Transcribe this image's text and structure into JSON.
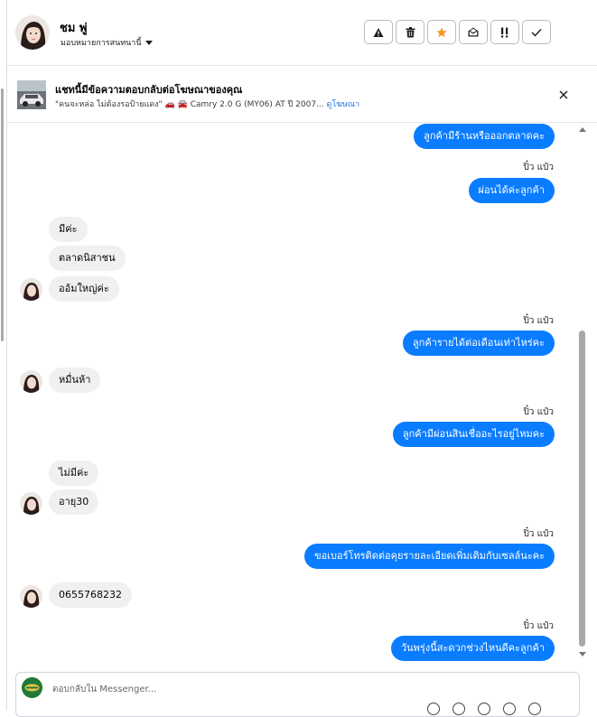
{
  "header": {
    "contact_name": "ชม พู่",
    "assign_label": "มอบหมายการสนทนานี้",
    "toolbar": [
      {
        "name": "spam-button",
        "icon": "warning-triangle-icon"
      },
      {
        "name": "delete-button",
        "icon": "trash-icon"
      },
      {
        "name": "star-button",
        "icon": "star-icon"
      },
      {
        "name": "mark-unread-button",
        "icon": "envelope-open-icon"
      },
      {
        "name": "follow-up-button",
        "icon": "exclamation-icon"
      },
      {
        "name": "done-button",
        "icon": "check-icon"
      }
    ],
    "star_color": "#f7931e"
  },
  "ad": {
    "title": "แชทนี้มีข้อความตอบกลับต่อโฆษณาของคุณ",
    "subtitle": "\"คนจะหล่อ ไม่ต้องรอป้ายแดง\" 🚗 🚘 Camry 2.0 G (MY06) AT ปี 2007...",
    "link": "ดูโฆษณา"
  },
  "messages": [
    {
      "dir": "out",
      "text": "ลูกค้ามีร้านหรือออกตลาดคะ"
    },
    {
      "dir": "out",
      "sender": "ปิ๋ว แป๋ว",
      "text": "ผ่อนได้ค่ะลูกค้า"
    },
    {
      "dir": "in",
      "text": "มีค่ะ"
    },
    {
      "dir": "in",
      "text": "ตลาดนิสาชน"
    },
    {
      "dir": "in",
      "text": "ออ้มใหญ่ค่ะ",
      "avatar": true
    },
    {
      "dir": "out",
      "sender": "ปิ๋ว แป๋ว",
      "text": "ลูกค้ารายได้ต่อเดือนเท่าไหร่คะ"
    },
    {
      "dir": "in",
      "text": "หมื่นห้า",
      "avatar": true
    },
    {
      "dir": "out",
      "sender": "ปิ๋ว แป๋ว",
      "text": "ลูกค้ามีผ่อนสินเชื่ออะไรอยู่ไหมคะ"
    },
    {
      "dir": "in",
      "text": "ไม่มีค่ะ"
    },
    {
      "dir": "in",
      "text": "อายุ30",
      "avatar": true
    },
    {
      "dir": "out",
      "sender": "ปิ๋ว แป๋ว",
      "text": "ขอเบอร์โทรติดต่อคุยรายละเอียดเพิ่มเติมกับเซลล์นะคะ"
    },
    {
      "dir": "in",
      "text": "0655768232",
      "avatar": true
    },
    {
      "dir": "out",
      "sender": "ปิ๋ว แป๋ว",
      "text": "วันพรุ่งนี้สะดวกช่วงไหนดีคะลูกค้า"
    }
  ],
  "composer": {
    "placeholder": "ตอบกลับใน Messenger..."
  },
  "colors": {
    "outgoing_bubble": "#0a7cff",
    "incoming_bubble": "#f0f0f0"
  }
}
